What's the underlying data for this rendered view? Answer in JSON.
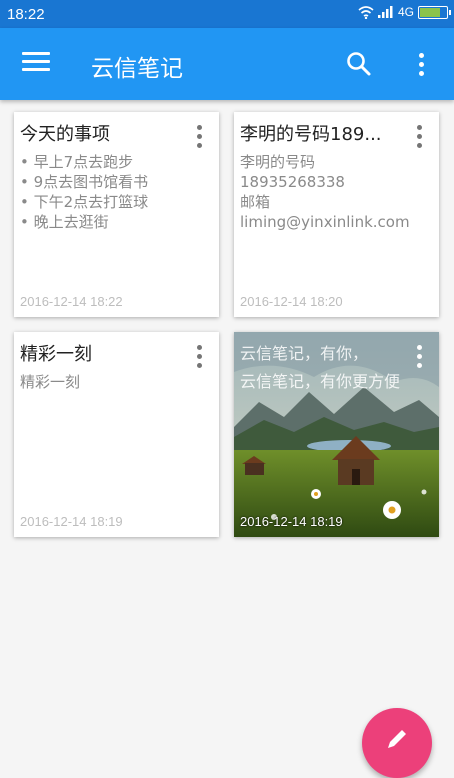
{
  "status_bar": {
    "time": "18:22",
    "network": "4G"
  },
  "app_bar": {
    "title": "云信笔记"
  },
  "notes": [
    {
      "title": "今天的事项",
      "lines": [
        "• 早上7点去跑步",
        "• 9点去图书馆看书",
        "• 下午2点去打篮球",
        "• 晚上去逛街"
      ],
      "date": "2016-12-14 18:22"
    },
    {
      "title": "李明的号码189...",
      "lines": [
        "李明的号码",
        "18935268338",
        "邮箱",
        "liming@yinxinlink.com"
      ],
      "date": "2016-12-14 18:20"
    },
    {
      "title": "精彩一刻",
      "lines": [
        "精彩一刻"
      ],
      "date": "2016-12-14 18:19"
    },
    {
      "title": "云信笔记，有你，",
      "lines": [
        "云信笔记，有你更方便"
      ],
      "date": "2016-12-14 18:19"
    }
  ],
  "colors": {
    "primary": "#2196f3",
    "status_bar": "#1976d2",
    "fab": "#ec407a"
  },
  "icons": {
    "menu": "menu-icon",
    "search": "search-icon",
    "more": "more-vert-icon",
    "fab": "edit-icon"
  }
}
